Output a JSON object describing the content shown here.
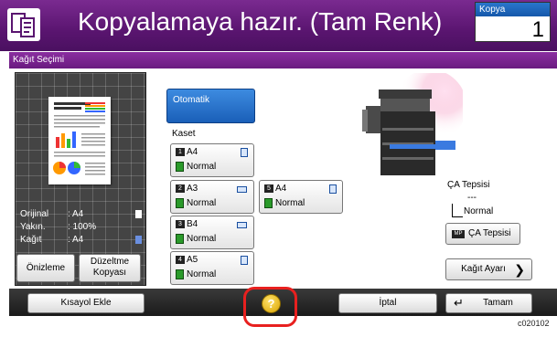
{
  "header": {
    "title": "Kopyalamaya hazır. (Tam Renk)",
    "kopya_label": "Kopya",
    "kopya_count": "1"
  },
  "section": {
    "title": "Kağıt Seçimi"
  },
  "preview": {
    "rows": [
      {
        "key": "Orijinal",
        "value": ": A4"
      },
      {
        "key": "Yakın.",
        "value": ": 100%"
      },
      {
        "key": "Kağıt",
        "value": ": A4"
      }
    ],
    "onizleme_label": "Önizleme",
    "duzeltme_label_1": "Düzeltme",
    "duzeltme_label_2": "Kopyası"
  },
  "auto_button": {
    "label": "Otomatik"
  },
  "kaset_label": "Kaset",
  "trays": [
    {
      "num": "1",
      "size": "A4",
      "type": "Normal"
    },
    {
      "num": "2",
      "size": "A3",
      "type": "Normal"
    },
    {
      "num": "5",
      "size": "A4",
      "type": "Normal"
    },
    {
      "num": "3",
      "size": "B4",
      "type": "Normal"
    },
    {
      "num": "4",
      "size": "A5",
      "type": "Normal"
    }
  ],
  "bypass": {
    "title": "ÇA Tepsisi",
    "dash": "---",
    "type": "Normal",
    "button_num": "MP",
    "button_label": "ÇA Tepsisi"
  },
  "paper_settings_label": "Kağıt Ayarı",
  "footer": {
    "kisayol_label": "Kısayol Ekle",
    "help_label": "?",
    "iptal_label": "İptal",
    "tamam_label": "Tamam"
  },
  "code": "c020102",
  "colors": {
    "header": "#5a1570",
    "accent_blue": "#1a5fb8",
    "highlight_ring": "#e8201f",
    "paper_green": "#2a9a2a"
  }
}
